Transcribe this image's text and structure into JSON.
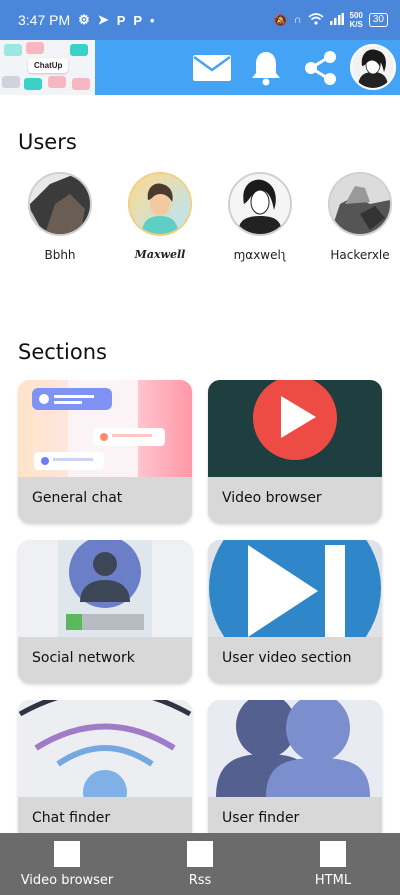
{
  "status_bar": {
    "time": "3:47 PM",
    "net_speed": "500",
    "net_unit": "K/S",
    "battery": "30"
  },
  "app_bar": {
    "logo_text": "ChatUp",
    "icons": [
      "mail-icon",
      "bell-icon",
      "share-icon",
      "profile-avatar"
    ]
  },
  "users": {
    "title": "Users",
    "items": [
      {
        "name": "Bbhh"
      },
      {
        "name": "Maxwell"
      },
      {
        "name": "ɱαxwelʅ"
      },
      {
        "name": "Hackerxle"
      }
    ]
  },
  "sections": {
    "title": "Sections",
    "items": [
      {
        "label": "General chat"
      },
      {
        "label": "Video browser"
      },
      {
        "label": "Social network"
      },
      {
        "label": "User video section"
      },
      {
        "label": "Chat finder"
      },
      {
        "label": "User finder"
      }
    ]
  },
  "bottom_nav": {
    "items": [
      {
        "label": "Video browser"
      },
      {
        "label": "Rss"
      },
      {
        "label": "HTML"
      }
    ]
  },
  "colors": {
    "status_bar": "#4a86d9",
    "app_bar": "#44a3f5",
    "card_footer": "#d8d8d8",
    "bottom_nav": "#6b6b6b"
  }
}
